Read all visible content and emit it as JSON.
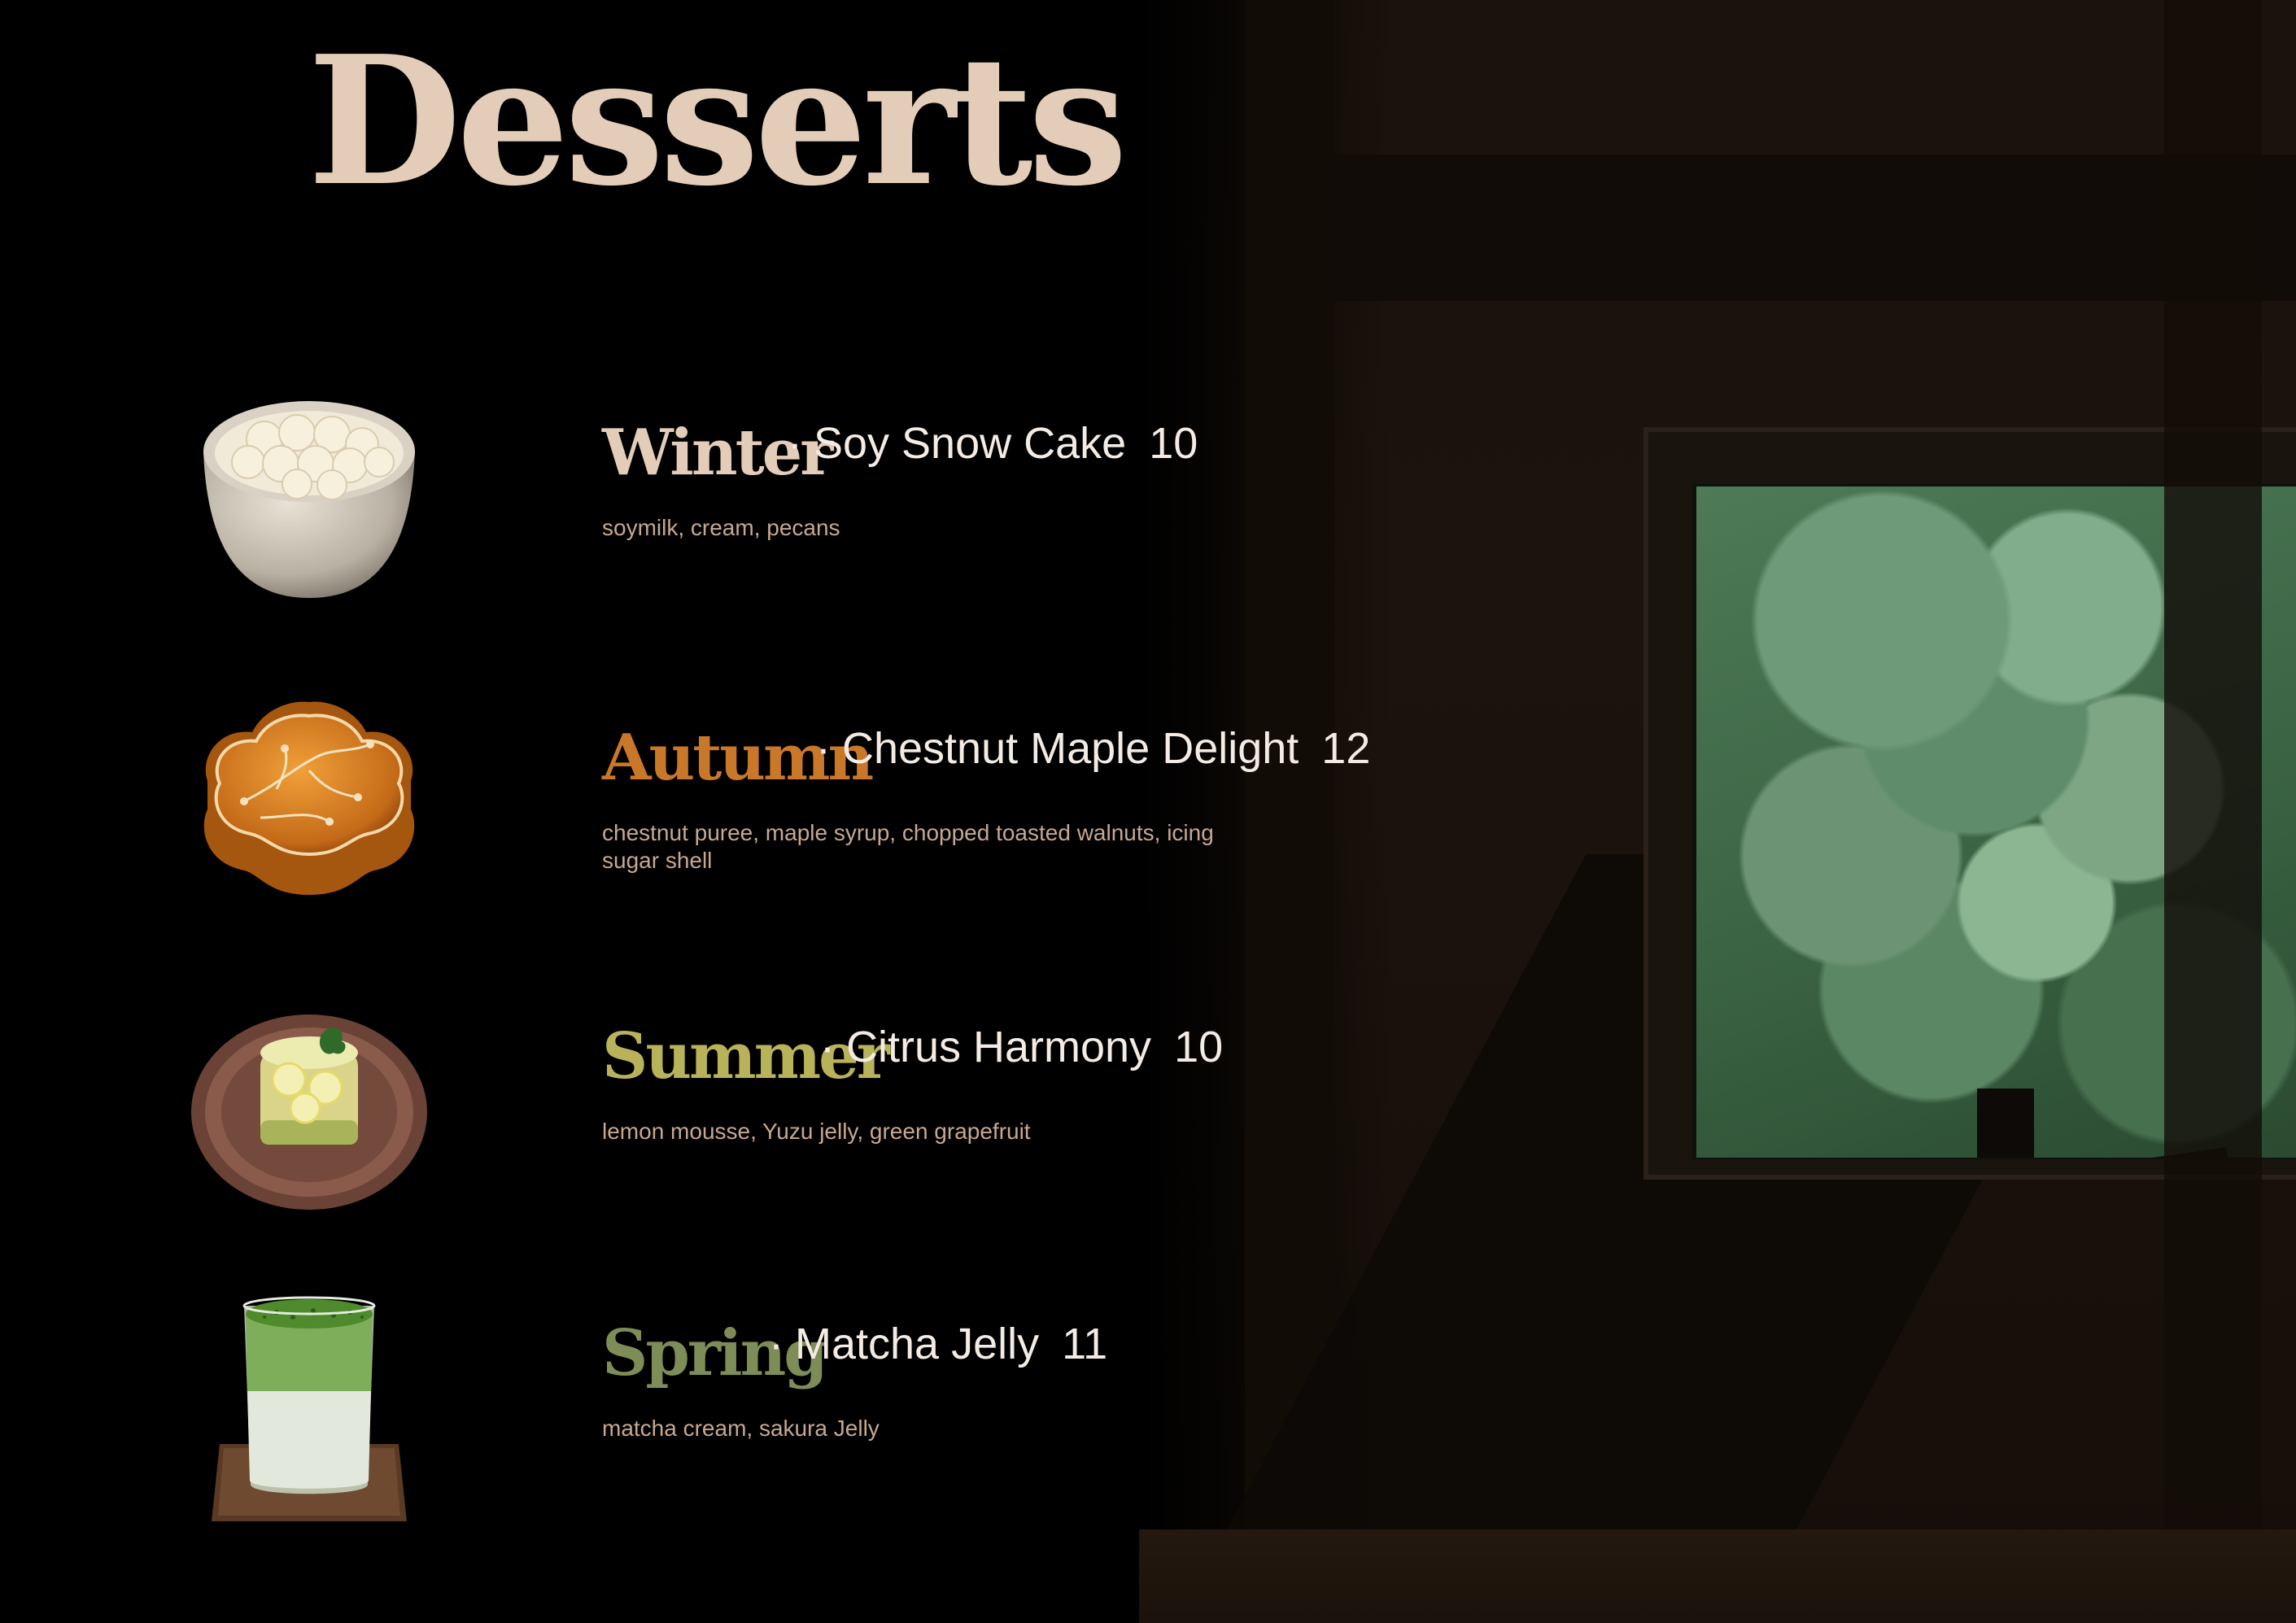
{
  "menu": {
    "title": "Desserts",
    "items": [
      {
        "season": "Winter",
        "season_color": "#e3cdb9",
        "separator": "·",
        "name": "Soy Snow Cake",
        "price": "10",
        "description": "soymilk, cream, pecans",
        "image_icon": "snow-cake-image"
      },
      {
        "season": "Autumn",
        "season_color": "#c9782a",
        "separator": "·",
        "name": "Chestnut Maple Delight",
        "price": "12",
        "description": "chestnut puree, maple syrup, chopped toasted walnuts, icing sugar shell",
        "image_icon": "chestnut-cake-image"
      },
      {
        "season": "Summer",
        "season_color": "#b8b25a",
        "separator": "·",
        "name": "Citrus Harmony",
        "price": "10",
        "description": "lemon mousse, Yuzu jelly, green grapefruit",
        "image_icon": "citrus-mousse-image"
      },
      {
        "season": "Spring",
        "season_color": "#7e8d57",
        "separator": "·",
        "name": "Matcha Jelly",
        "price": "11",
        "description": "matcha cream, sakura Jelly",
        "image_icon": "matcha-jelly-image"
      }
    ]
  },
  "colors": {
    "background": "#000000",
    "title": "#e3cdb9",
    "dish_text": "#f4ece4",
    "description": "#c7a890"
  }
}
